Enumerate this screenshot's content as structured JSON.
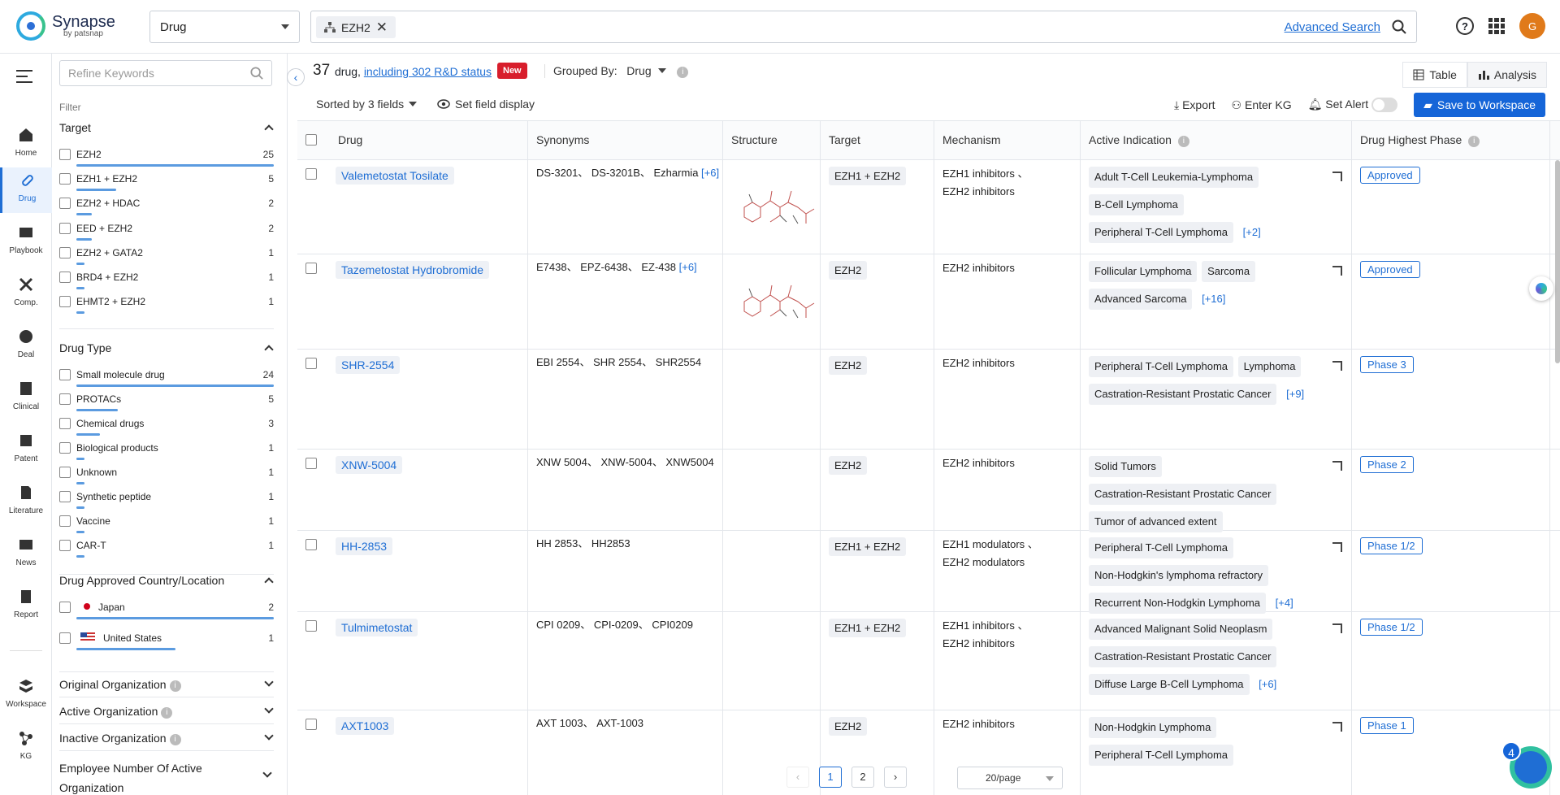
{
  "app": {
    "name": "Synapse",
    "sub": "by patsnap"
  },
  "search": {
    "type_value": "Drug",
    "query_chip": "EZH2",
    "advanced_label": "Advanced Search"
  },
  "user": {
    "avatar_letter": "G"
  },
  "nav": [
    {
      "label": "Home",
      "icon": "home-icon"
    },
    {
      "label": "Drug",
      "icon": "pill-icon"
    },
    {
      "label": "Playbook",
      "icon": "playbook-icon"
    },
    {
      "label": "Comp.",
      "icon": "competition-icon"
    },
    {
      "label": "Deal",
      "icon": "deal-icon"
    },
    {
      "label": "Clinical",
      "icon": "clinical-icon"
    },
    {
      "label": "Patent",
      "icon": "patent-icon"
    },
    {
      "label": "Literature",
      "icon": "literature-icon"
    },
    {
      "label": "News",
      "icon": "news-icon"
    },
    {
      "label": "Report",
      "icon": "report-icon"
    },
    {
      "label": "Workspace",
      "icon": "workspace-icon"
    },
    {
      "label": "KG",
      "icon": "kg-icon"
    }
  ],
  "filter": {
    "refine_placeholder": "Refine Keywords",
    "label": "Filter",
    "target": {
      "title": "Target",
      "items": [
        {
          "label": "EZH2",
          "count": "25",
          "ratio": 1.0
        },
        {
          "label": "EZH1 + EZH2",
          "count": "5",
          "ratio": 0.2
        },
        {
          "label": "EZH2 + HDAC",
          "count": "2",
          "ratio": 0.08
        },
        {
          "label": "EED + EZH2",
          "count": "2",
          "ratio": 0.08
        },
        {
          "label": "EZH2 + GATA2",
          "count": "1",
          "ratio": 0.04
        },
        {
          "label": "BRD4 + EZH2",
          "count": "1",
          "ratio": 0.04
        },
        {
          "label": "EHMT2 + EZH2",
          "count": "1",
          "ratio": 0.04
        }
      ]
    },
    "drug_type": {
      "title": "Drug Type",
      "items": [
        {
          "label": "Small molecule drug",
          "count": "24",
          "ratio": 1.0
        },
        {
          "label": "PROTACs",
          "count": "5",
          "ratio": 0.21
        },
        {
          "label": "Chemical drugs",
          "count": "3",
          "ratio": 0.12
        },
        {
          "label": "Biological products",
          "count": "1",
          "ratio": 0.04
        },
        {
          "label": "Unknown",
          "count": "1",
          "ratio": 0.04
        },
        {
          "label": "Synthetic peptide",
          "count": "1",
          "ratio": 0.04
        },
        {
          "label": "Vaccine",
          "count": "1",
          "ratio": 0.04
        },
        {
          "label": "CAR-T",
          "count": "1",
          "ratio": 0.04
        }
      ]
    },
    "approved_country": {
      "title": "Drug Approved Country/Location",
      "items": [
        {
          "label": "Japan",
          "count": "2",
          "ratio": 1.0
        },
        {
          "label": "United States",
          "count": "1",
          "ratio": 0.5
        }
      ]
    },
    "collapsed": [
      "Original Organization",
      "Active Organization",
      "Inactive Organization"
    ],
    "employee": "Employee Number Of Active Organization"
  },
  "results": {
    "count": "37",
    "count_suffix": "drug,",
    "rd_link": "including 302 R&D status",
    "new_badge": "New",
    "grouped_label": "Grouped By:",
    "grouped_value": "Drug",
    "sorted_label": "Sorted by 3 fields",
    "set_field_label": "Set field display",
    "export": "Export",
    "enter_kg": "Enter KG",
    "set_alert": "Set Alert",
    "save": "Save to Workspace",
    "tab_table": "Table",
    "tab_analysis": "Analysis"
  },
  "table": {
    "columns": [
      "Drug",
      "Synonyms",
      "Structure",
      "Target",
      "Mechanism",
      "Active Indication",
      "Drug Highest Phase"
    ],
    "rows": [
      {
        "drug": "Valemetostat Tosilate",
        "synonyms": "DS-3201、 DS-3201B、 Ezharmia",
        "syn_more": "[+6]",
        "target": "EZH1 + EZH2",
        "mechanism": [
          "EZH1 inhibitors 、",
          "EZH2 inhibitors"
        ],
        "indications": [
          "Adult T-Cell Leukemia-Lymphoma",
          "B-Cell Lymphoma",
          "Peripheral T-Cell Lymphoma"
        ],
        "ind_more": "[+2]",
        "phase": "Approved"
      },
      {
        "drug": "Tazemetostat Hydrobromide",
        "synonyms": "E7438、 EPZ-6438、 EZ-438",
        "syn_more": "[+6]",
        "target": "EZH2",
        "mechanism": [
          "EZH2 inhibitors"
        ],
        "indications": [
          "Follicular Lymphoma",
          "Sarcoma",
          "Advanced Sarcoma"
        ],
        "ind_more": "[+16]",
        "phase": "Approved"
      },
      {
        "drug": "SHR-2554",
        "synonyms": "EBI 2554、 SHR 2554、 SHR2554",
        "syn_more": "",
        "target": "EZH2",
        "mechanism": [
          "EZH2 inhibitors"
        ],
        "indications": [
          "Peripheral T-Cell Lymphoma",
          "Lymphoma",
          "Castration-Resistant Prostatic Cancer"
        ],
        "ind_more": "[+9]",
        "phase": "Phase 3"
      },
      {
        "drug": "XNW-5004",
        "synonyms": "XNW 5004、 XNW-5004、 XNW5004",
        "syn_more": "",
        "target": "EZH2",
        "mechanism": [
          "EZH2 inhibitors"
        ],
        "indications": [
          "Solid Tumors",
          "Castration-Resistant Prostatic Cancer",
          "Tumor of advanced extent"
        ],
        "ind_more": "",
        "phase": "Phase 2"
      },
      {
        "drug": "HH-2853",
        "synonyms": "HH 2853、 HH2853",
        "syn_more": "",
        "target": "EZH1 + EZH2",
        "mechanism": [
          "EZH1 modulators 、",
          "EZH2 modulators"
        ],
        "indications": [
          "Peripheral T-Cell Lymphoma",
          "Non-Hodgkin's lymphoma refractory",
          "Recurrent Non-Hodgkin Lymphoma"
        ],
        "ind_more": "[+4]",
        "phase": "Phase 1/2"
      },
      {
        "drug": "Tulmimetostat",
        "synonyms": "CPI 0209、 CPI-0209、 CPI0209",
        "syn_more": "",
        "target": "EZH1 + EZH2",
        "mechanism": [
          "EZH1 inhibitors 、",
          "EZH2 inhibitors"
        ],
        "indications": [
          "Advanced Malignant Solid Neoplasm",
          "Castration-Resistant Prostatic Cancer",
          "Diffuse Large B-Cell Lymphoma"
        ],
        "ind_more": "[+6]",
        "phase": "Phase 1/2"
      },
      {
        "drug": "AXT1003",
        "synonyms": "AXT 1003、 AXT-1003",
        "syn_more": "",
        "target": "EZH2",
        "mechanism": [
          "EZH2 inhibitors"
        ],
        "indications": [
          "Non-Hodgkin Lymphoma",
          "Peripheral T-Cell Lymphoma"
        ],
        "ind_more": "",
        "phase": "Phase 1"
      }
    ]
  },
  "pagination": {
    "pages": [
      "1",
      "2"
    ],
    "current": "1",
    "per_page": "20/page"
  },
  "chat": {
    "badge": "4"
  }
}
